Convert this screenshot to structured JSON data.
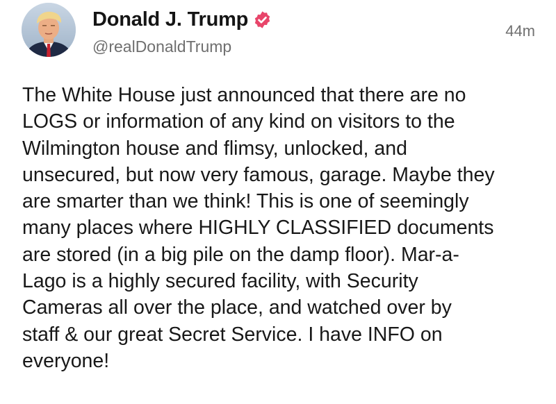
{
  "post": {
    "author": {
      "display_name": "Donald J. Trump",
      "handle": "@realDonaldTrump",
      "verified": true,
      "avatar_icon": "profile-photo"
    },
    "timestamp": "44m",
    "body_lines": [
      "The White House just announced that there are no",
      "LOGS or information of any kind on visitors to the",
      "Wilmington house and flimsy, unlocked, and",
      "unsecured, but now very famous, garage. Maybe they",
      "are smarter than we think! This is one of seemingly",
      "many places where HIGHLY CLASSIFIED documents",
      "are stored (in a big pile on the damp floor). Mar-a-",
      "Lago is a highly secured facility, with Security",
      "Cameras all over the place, and watched over by",
      "staff & our great Secret Service. I have INFO on",
      "everyone!"
    ]
  },
  "colors": {
    "verified_badge": "#e8456a",
    "text": "#181818",
    "muted": "#6f6f6f",
    "background": "#ffffff"
  }
}
